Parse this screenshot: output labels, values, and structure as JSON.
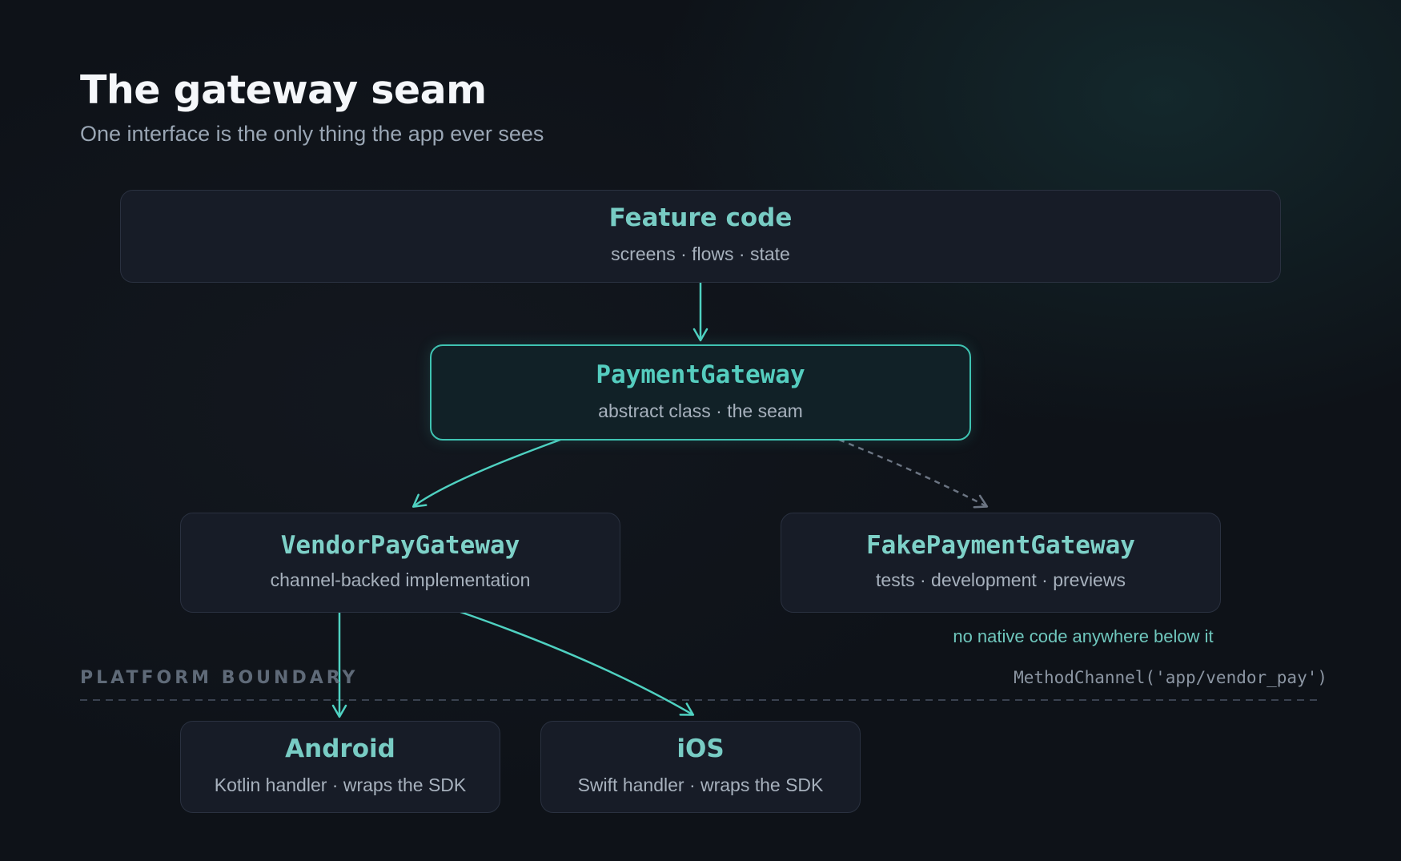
{
  "header": {
    "title": "The gateway seam",
    "subtitle": "One interface is the only thing the app ever sees"
  },
  "nodes": {
    "feature_code": {
      "name": "Feature code",
      "desc": "screens · flows · state"
    },
    "payment_gateway": {
      "name": "PaymentGateway",
      "desc": "abstract class · the seam"
    },
    "vendor_pay_gateway": {
      "name": "VendorPayGateway",
      "desc": "channel-backed implementation"
    },
    "fake_payment_gateway": {
      "name": "FakePaymentGateway",
      "desc": "tests · development · previews"
    },
    "android": {
      "name": "Android",
      "desc": "Kotlin handler · wraps the SDK"
    },
    "ios": {
      "name": "iOS",
      "desc": "Swift handler · wraps the SDK"
    }
  },
  "annotations": {
    "fake_note": "no native code anywhere below it",
    "platform_boundary": "PLATFORM BOUNDARY",
    "method_channel": "MethodChannel('app/vendor_pay')"
  },
  "colors": {
    "accent": "#4fd1c1",
    "dashed_edge": "#6b7482",
    "boundary_line": "#3a4250"
  }
}
